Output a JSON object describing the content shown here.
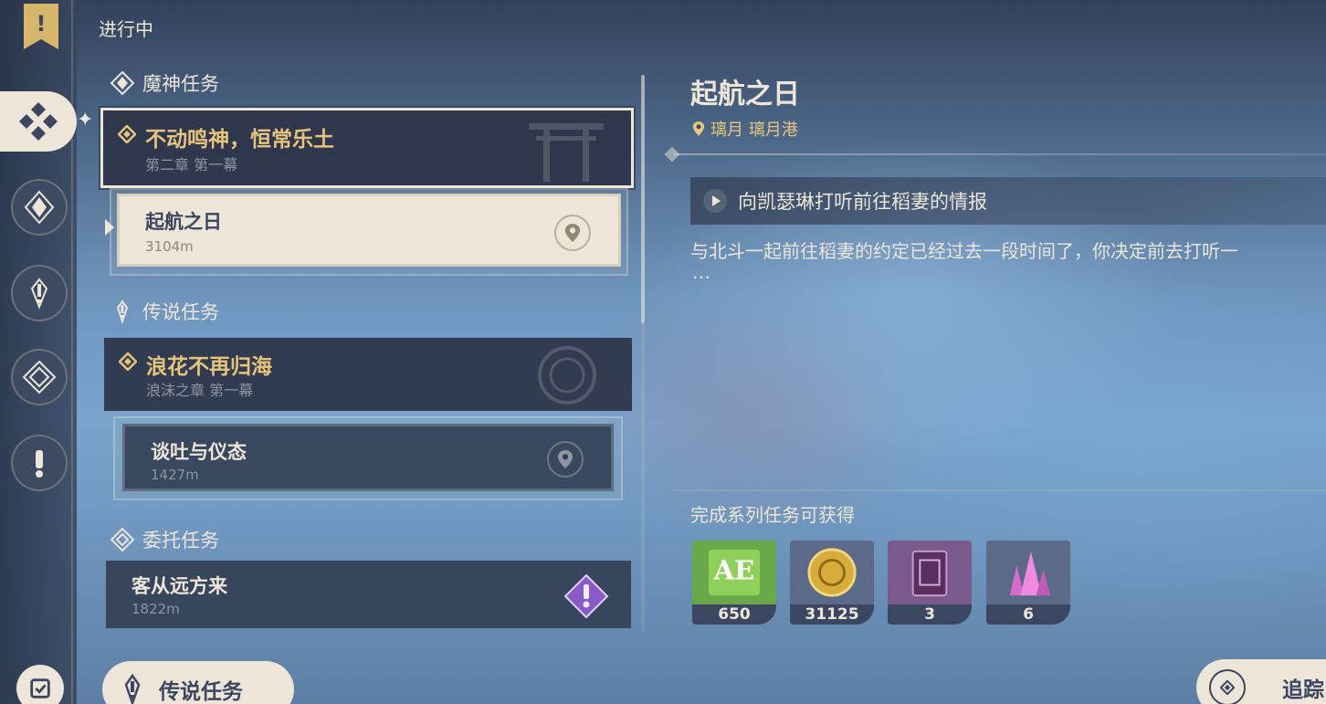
{
  "panel": {
    "title": "进行中"
  },
  "categories": {
    "archon": "魔神任务",
    "legend": "传说任务",
    "commission": "委托任务"
  },
  "archon_quest": {
    "name": "不动鸣神，恒常乐土",
    "chapter": "第二章 第一幕",
    "sub": {
      "name": "起航之日",
      "distance": "3104m"
    }
  },
  "legend_quest": {
    "name": "浪花不再归海",
    "chapter": "浪沫之章 第一幕",
    "sub": {
      "name": "谈吐与仪态",
      "distance": "1427m"
    }
  },
  "commission_quest": {
    "name": "客从远方来",
    "distance": "1822m"
  },
  "bottom_left_button": "传说任务",
  "detail": {
    "title": "起航之日",
    "location": "璃月 璃月港",
    "objective": "向凯瑟琳打听前往稻妻的情报",
    "description": "与北斗一起前往稻妻的约定已经过去一段时间了，你决定前去打听一",
    "ellipsis": "…",
    "rewards_label": "完成系列任务可获得",
    "rewards": [
      {
        "icon": "adventure-exp-icon",
        "count": "650",
        "color": "#5aa83c"
      },
      {
        "icon": "mora-coin-icon",
        "count": "31125",
        "color": "#c9a035"
      },
      {
        "icon": "heros-wit-book-icon",
        "count": "3",
        "color": "#6a4a7a"
      },
      {
        "icon": "primogem-crystal-icon",
        "count": "6",
        "color": "#c05ab0"
      }
    ],
    "track_button": "追踪"
  },
  "colors": {
    "cream": "#ece5d8",
    "navy": "#3b4660",
    "gold": "#e6c47a"
  }
}
